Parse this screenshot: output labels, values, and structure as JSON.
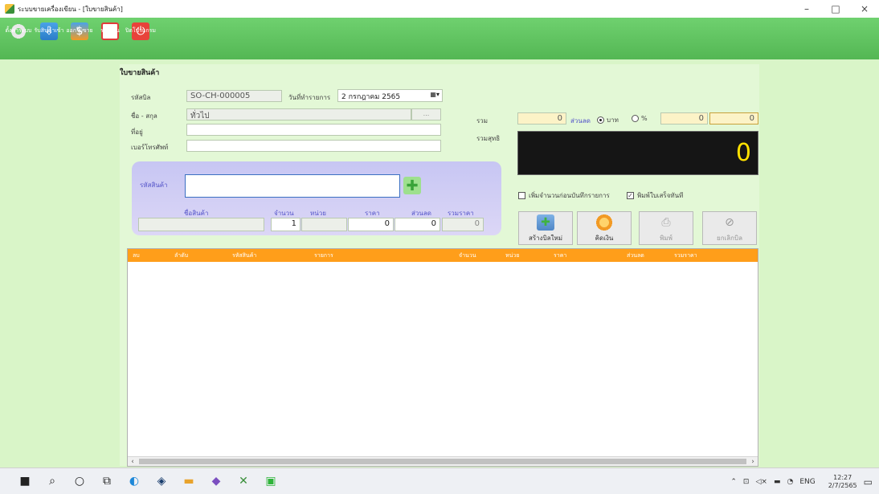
{
  "window": {
    "title": "ระบบขายเครื่องเขียน - [ใบขายสินค้า]",
    "minimize": "–",
    "maximize": "□",
    "close": "×"
  },
  "toolbar": [
    {
      "label": "ตั้งค่าระบบ",
      "icon": "gear-icon",
      "glyph": "⚙"
    },
    {
      "label": "รับสินค้าเข้า",
      "icon": "receive-goods-icon",
      "glyph": "⇩"
    },
    {
      "label": "ออกใบขาย",
      "icon": "sales-invoice-icon",
      "glyph": "$"
    },
    {
      "label": "รายงาน",
      "icon": "report-icon",
      "glyph": "▤"
    },
    {
      "label": "ปิดโปรแกรม",
      "icon": "power-icon",
      "glyph": "⏻"
    }
  ],
  "form": {
    "title": "ใบขายสินค้า",
    "bill_no_label": "รหัสบิล",
    "bill_no": "SO-CH-000005",
    "date_label": "วันที่ทำรายการ",
    "date_value": "2 กรกฎาคม  2565",
    "customer_label": "ชื่อ - สกุล",
    "customer": "ทั่วไป",
    "customer_btn": "...",
    "address_label": "ที่อยู่",
    "address": "",
    "phone_label": "เบอร์โทรศัพท์",
    "phone": "",
    "total_label": "รวม",
    "total": "0",
    "discount_label": "ส่วนลด",
    "discount_baht": "บาท",
    "discount_percent": "%",
    "discount_pct_value": "0",
    "discount_value": "0",
    "net_label": "รวมสุทธิ",
    "net_total": "0"
  },
  "entry": {
    "product_code_label": "รหัสสินค้า",
    "product_code": "",
    "name_label": "ชื่อสินค้า",
    "qty_label": "จำนวน",
    "unit_label": "หน่วย",
    "price_label": "ราคา",
    "discount_label": "ส่วนลด",
    "sum_label": "รวมราคา",
    "name": "",
    "qty": "1",
    "unit": "",
    "price": "0",
    "discount": "0",
    "sum": "0"
  },
  "options": {
    "add_qty_label": "เพิ่มจำนวนก่อนบันทึกรายการ",
    "print_label": "พิมพ์ใบเสร็จทันที"
  },
  "actions": {
    "new_bill": "สร้างบิลใหม่",
    "pay": "คิดเงิน",
    "print": "พิมพ์",
    "cancel": "ยกเลิกบิล"
  },
  "grid": {
    "columns": [
      "ลบ",
      "ลำดับ",
      "รหัสสินค้า",
      "รายการ",
      "จำนวน",
      "หน่วย",
      "ราคา",
      "ส่วนลด",
      "รวมราคา"
    ],
    "rows": []
  },
  "taskbar": {
    "language": "ENG",
    "time": "12:27",
    "date": "2/7/2565"
  }
}
